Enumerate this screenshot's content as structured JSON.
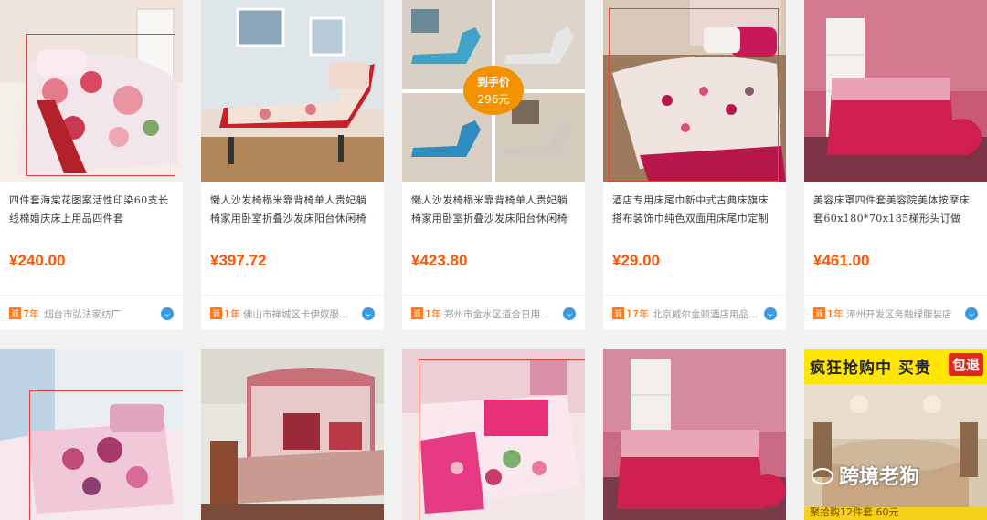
{
  "products": [
    {
      "title": "四件套海棠花图案活性印染60支长线棉婚庆床上用品四件套",
      "price": "¥240.00",
      "years": "7年",
      "shop": "烟台市弘法家纺厂"
    },
    {
      "title": "懒人沙发椅榻米靠背椅单人贵妃躺椅家用卧室折叠沙发床阳台休闲椅",
      "price": "¥397.72",
      "years": "1年",
      "shop": "佛山市禅城区卡伊奴服..."
    },
    {
      "title": "懒人沙发椅榻米靠背椅单人贵妃躺椅家用卧室折叠沙发床阳台休闲椅",
      "price": "¥423.80",
      "years": "1年",
      "shop": "郑州市金水区道合日用..."
    },
    {
      "title": "酒店专用床尾巾新中式古典床旗床搭布装饰巾纯色双面用床尾巾定制",
      "price": "¥29.00",
      "years": "17年",
      "shop": "北京威尔金顿酒店用品..."
    },
    {
      "title": "美容床罩四件套美容院美体按摩床套60x180*70x185梯形头订做",
      "price": "¥461.00",
      "years": "1年",
      "shop": "漳州开发区务融绿服装店"
    }
  ],
  "badge_label": "诚",
  "promo": {
    "line1": "到手价",
    "line2": "296元"
  },
  "ad_banner": {
    "text": "疯狂抢购中 买贵",
    "tag": "包退",
    "bottom": "聚拾购12件套 60元"
  },
  "watermark": "跨境老狗",
  "colors": {
    "price": "#ff5500",
    "badge": "#ff7a1a",
    "highlight": "#e8403a"
  }
}
